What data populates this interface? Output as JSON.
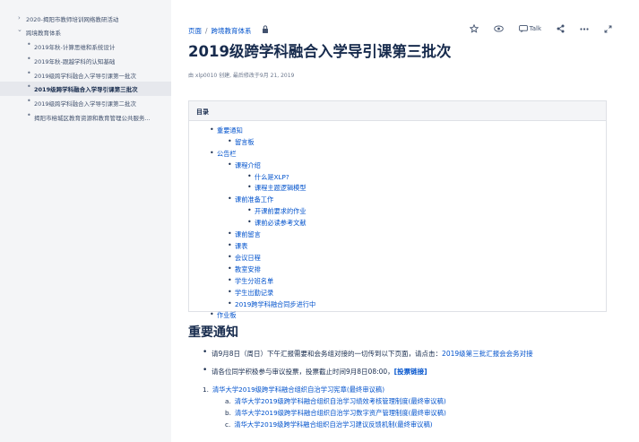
{
  "sidebar": {
    "items": [
      {
        "label": "2020-揭阳市教师培训网络教研活动",
        "level": 0,
        "twisty": "›",
        "active": false
      },
      {
        "label": "跨境教育体系",
        "level": 0,
        "twisty": "⌄",
        "active": false
      },
      {
        "label": "2019年秋-计算思维和系统设计",
        "level": 1,
        "active": false
      },
      {
        "label": "2019年秋-跟越学科的认知基础",
        "level": 1,
        "active": false
      },
      {
        "label": "2019级跨学科融合入学导引课第一批次",
        "level": 1,
        "active": false
      },
      {
        "label": "2019级跨学科融合入学导引课第三批次",
        "level": 1,
        "active": true
      },
      {
        "label": "2019级跨学科融合入学导引课第二批次",
        "level": 1,
        "active": false
      },
      {
        "label": "揭阳市榕城区教育资源和教育管理公共服务...",
        "level": 1,
        "active": false
      }
    ]
  },
  "breadcrumb": {
    "items": [
      "页面",
      "跨境教育体系"
    ],
    "separator": "/"
  },
  "toolbar": {
    "talk_label": "Talk"
  },
  "page": {
    "title": "2019级跨学科融合入学导引课第三批次",
    "byline": "由 xlp0010 创建, 最后修改于9月 21, 2019"
  },
  "toc": {
    "heading": "目录",
    "items": [
      {
        "label": "重要通知",
        "level": 0
      },
      {
        "label": "留言板",
        "level": 1
      },
      {
        "label": "公告栏",
        "level": 0
      },
      {
        "label": "课程介绍",
        "level": 1
      },
      {
        "label": "什么是XLP?",
        "level": 2
      },
      {
        "label": "课程主题逻辑模型",
        "level": 2
      },
      {
        "label": "课前准备工作",
        "level": 1
      },
      {
        "label": "开课前要求的作业",
        "level": 2
      },
      {
        "label": "课前必读参考文献",
        "level": 2
      },
      {
        "label": "课前留言",
        "level": 1
      },
      {
        "label": "课表",
        "level": 1
      },
      {
        "label": "会议日程",
        "level": 1
      },
      {
        "label": "教室安排",
        "level": 1
      },
      {
        "label": "学生分班名单",
        "level": 1
      },
      {
        "label": "学生出勤记录",
        "level": 1
      },
      {
        "label": "2019跨学科融合同步进行中",
        "level": 1
      },
      {
        "label": "作业板",
        "level": 0
      }
    ]
  },
  "section": {
    "heading": "重要通知",
    "notices": [
      {
        "text": "请9月8日（周日）下午汇报需要和会务组对接的一切传到以下页面，请点击：",
        "link": "2019级第三批汇报会会务对接"
      },
      {
        "text": "请各位同学积极参与审议投票，投票截止时间9月8日08:00，",
        "link": "[投票链接]"
      }
    ],
    "ordered": [
      {
        "num": "1.",
        "label": "清华大学2019级跨学科融合组织自治学习宪章(最终审议稿)"
      },
      {
        "num": "a.",
        "label": "清华大学2019级跨学科融合组织自治学习绩效考核管理制度(最终审议稿)"
      },
      {
        "num": "b.",
        "label": "清华大学2019级跨学科融合组织自治学习数字资产管理制度(最终审议稿)"
      },
      {
        "num": "c.",
        "label": "清华大学2019级跨学科融合组织自治学习建议反馈机制(最终审议稿)"
      }
    ]
  },
  "colors": {
    "link": "#0052cc",
    "text": "#172b4d",
    "sidebar_bg": "#f4f5f7"
  }
}
